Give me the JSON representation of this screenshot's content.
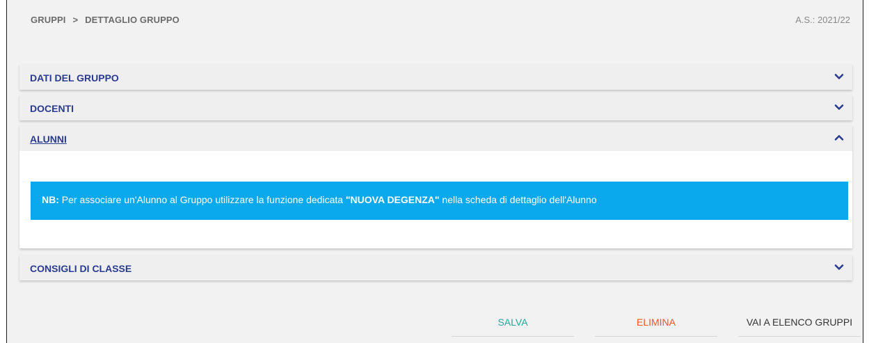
{
  "breadcrumb": {
    "item1": "GRUPPI",
    "separator": ">",
    "item2": "DETTAGLIO GRUPPO"
  },
  "school_year": "A.S.: 2021/22",
  "panels": [
    {
      "title": "DATI DEL GRUPPO",
      "expanded": false
    },
    {
      "title": "DOCENTI",
      "expanded": false
    },
    {
      "title": "ALUNNI",
      "expanded": true
    },
    {
      "title": "CONSIGLI DI CLASSE",
      "expanded": false
    }
  ],
  "note": {
    "prefix": "NB:",
    "text_before": " Per associare un'Alunno al Gruppo utilizzare la funzione dedicata ",
    "highlight": "\"NUOVA DEGENZA\"",
    "text_after": " nella scheda di dettaglio dell'Alunno"
  },
  "buttons": {
    "save": "SALVA",
    "delete": "ELIMINA",
    "list": "VAI A ELENCO GRUPPI"
  },
  "colors": {
    "title": "#2a3b8f",
    "note_bg": "#0aa8ec",
    "save": "#26a69a",
    "delete": "#f4511e",
    "list": "#333333"
  },
  "icons": {
    "collapsed": "chevron-down-icon",
    "expanded": "chevron-up-icon"
  }
}
